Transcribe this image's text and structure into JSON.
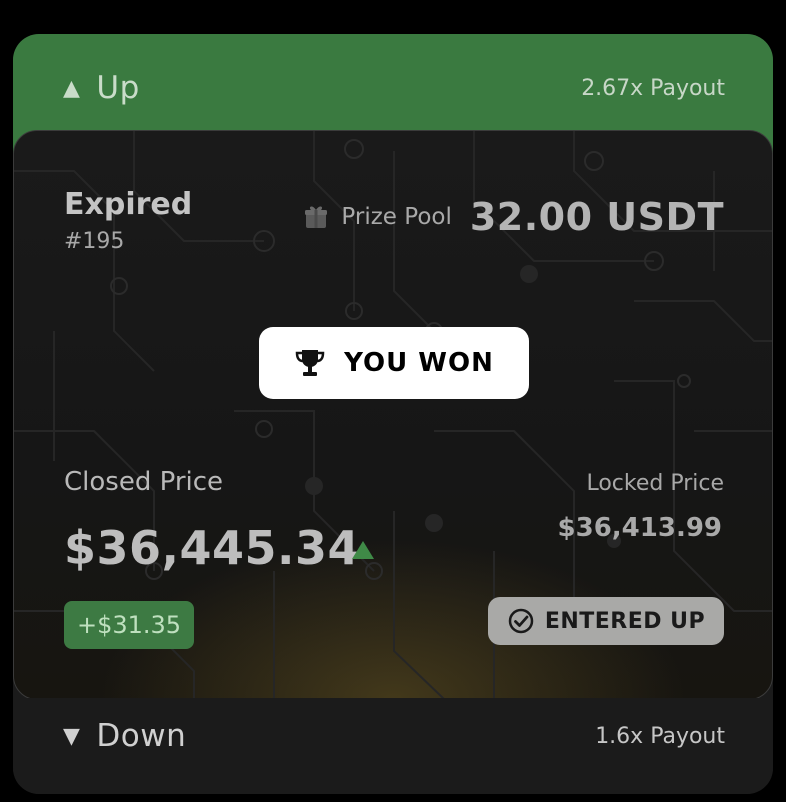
{
  "up": {
    "label": "Up",
    "payout": "2.67x Payout"
  },
  "down": {
    "label": "Down",
    "payout": "1.6x Payout"
  },
  "round": {
    "status": "Expired",
    "number": "#195",
    "prize_pool_label": "Prize Pool",
    "prize_pool_value": "32.00",
    "prize_pool_currency": "USDT"
  },
  "result": {
    "badge": "YOU WON"
  },
  "prices": {
    "closed_label": "Closed Price",
    "closed_value": "$36,445.34",
    "locked_label": "Locked Price",
    "locked_value": "$36,413.99",
    "change": "+$31.35"
  },
  "entry": {
    "label": "ENTERED UP"
  },
  "colors": {
    "accent_green": "#3a7a40",
    "panel": "#1a1a1a",
    "entered_badge": "#a9a9a7"
  }
}
